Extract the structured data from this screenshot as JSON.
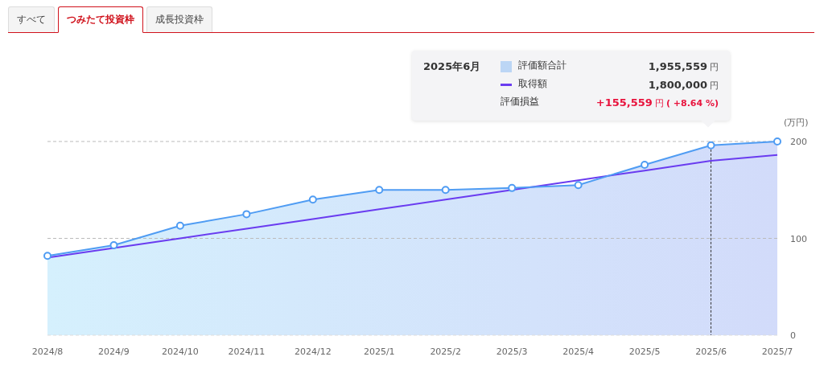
{
  "tabs": [
    {
      "label": "すべて",
      "selected": false
    },
    {
      "label": "つみたて投資枠",
      "selected": true
    },
    {
      "label": "成長投資枠",
      "selected": false
    }
  ],
  "chart": {
    "chart_data": {
      "type": "area",
      "categories": [
        "2024/8",
        "2024/9",
        "2024/10",
        "2024/11",
        "2024/12",
        "2025/1",
        "2025/2",
        "2025/3",
        "2025/4",
        "2025/5",
        "2025/6",
        "2025/7"
      ],
      "series": [
        {
          "name": "評価額合計",
          "type": "area",
          "color": "#4f9cf3",
          "values": [
            82,
            93,
            113,
            125,
            140,
            150,
            150,
            152,
            155,
            176,
            196,
            200
          ]
        },
        {
          "name": "取得額",
          "type": "line",
          "color": "#6a3cf0",
          "values": [
            80,
            90,
            100,
            110,
            120,
            130,
            140,
            150,
            160,
            170,
            180,
            186
          ]
        }
      ],
      "ylabel": "(万円)",
      "ylim": [
        0,
        200
      ],
      "yticks": [
        0,
        100,
        200
      ],
      "ref_lines": [
        {
          "axis": "y",
          "value": 100
        },
        {
          "axis": "y",
          "value": 200
        },
        {
          "axis": "x",
          "value": "2025/6"
        }
      ]
    }
  },
  "tooltip": {
    "title": "2025年6月",
    "rows": [
      {
        "kind": "area",
        "value": "1,955,559",
        "unit": "円"
      },
      {
        "kind": "line",
        "value": "1,800,000",
        "unit": "円"
      },
      {
        "kind": "gain",
        "label": "評価損益",
        "value": "+155,559",
        "unit": "円",
        "percent": "( +8.64 %)",
        "positive": true
      }
    ]
  }
}
